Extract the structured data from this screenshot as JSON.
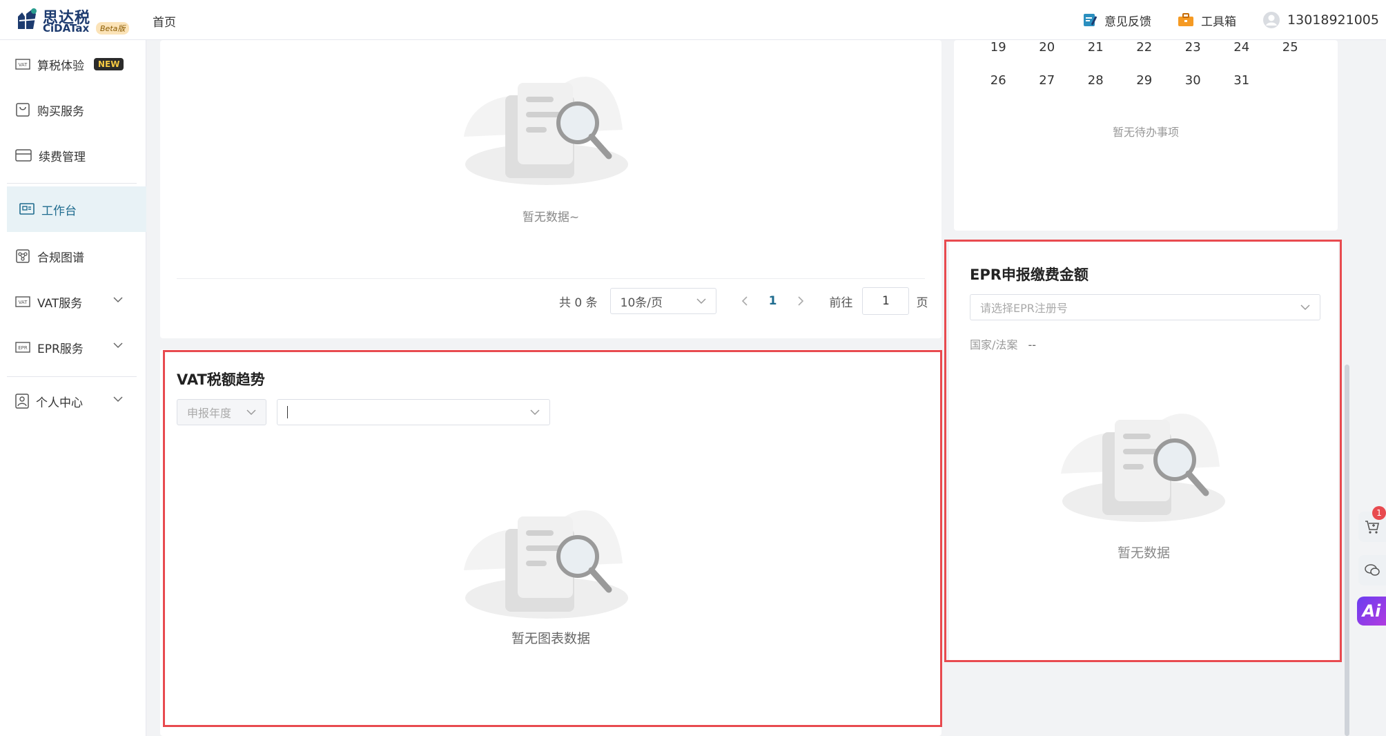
{
  "header": {
    "logo_cn": "思达税",
    "logo_en": "CiDATax",
    "beta": "Beta版",
    "nav_home": "首页",
    "feedback": "意见反馈",
    "toolbox": "工具箱",
    "phone": "13018921005"
  },
  "sidebar": {
    "items": [
      {
        "label": "算税体验",
        "badge": "NEW"
      },
      {
        "label": "购买服务"
      },
      {
        "label": "续费管理"
      },
      {
        "label": "工作台"
      },
      {
        "label": "合规图谱"
      },
      {
        "label": "VAT服务"
      },
      {
        "label": "EPR服务"
      },
      {
        "label": "个人中心"
      }
    ]
  },
  "top_card": {
    "empty_text": "暂无数据~",
    "pager": {
      "total": "共 0 条",
      "page_size": "10条/页",
      "current": "1",
      "goto_label": "前往",
      "goto_value": "1",
      "page_unit": "页"
    }
  },
  "calendar": {
    "rows": [
      [
        "19",
        "20",
        "21",
        "22",
        "23",
        "24",
        "25"
      ],
      [
        "26",
        "27",
        "28",
        "29",
        "30",
        "31",
        ""
      ]
    ],
    "empty_text": "暂无待办事项"
  },
  "vat_card": {
    "title": "VAT税额趋势",
    "year_select": "申报年度",
    "empty_text": "暂无图表数据"
  },
  "epr_card": {
    "title": "EPR申报缴费金额",
    "select_placeholder": "请选择EPR注册号",
    "country_label": "国家/法案",
    "country_value": "--",
    "empty_text": "暂无数据"
  },
  "float": {
    "cart_count": "1",
    "ai_label": "Ai"
  },
  "colors": {
    "accent": "#1e6b8e",
    "highlight": "#e84a4f",
    "active_bg": "#e8f2f6"
  }
}
